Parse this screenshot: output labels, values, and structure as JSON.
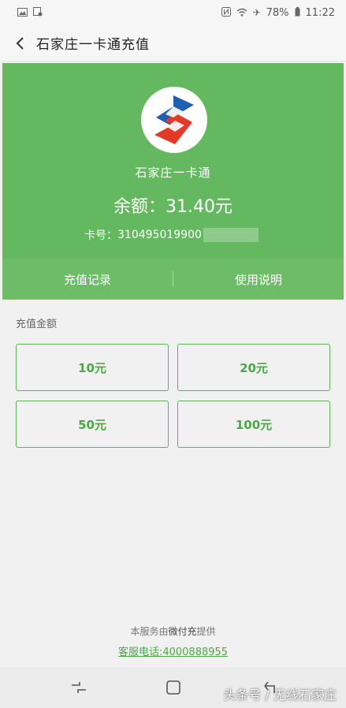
{
  "status_bar": {
    "battery": "78%",
    "time": "11:22"
  },
  "header": {
    "title": "石家庄一卡通充值"
  },
  "card": {
    "name": "石家庄一卡通",
    "balance": "余额：31.40元",
    "card_no_label": "卡号：",
    "card_no_visible": "310495019900",
    "actions": {
      "recharge_records": "充值记录",
      "usage_guide": "使用说明"
    }
  },
  "recharge": {
    "section_label": "充值金额",
    "amounts": [
      "10元",
      "20元",
      "50元",
      "100元"
    ]
  },
  "footer": {
    "provider_prefix": "本服务由",
    "provider_name": "微付充",
    "provider_suffix": "提供",
    "hotline": "客服电话:4000888955"
  },
  "watermark": "头条号 / 无线石家庄",
  "colors": {
    "primary_green": "#64b85f",
    "amount_text": "#4aa947",
    "background": "#f1f1f1"
  }
}
